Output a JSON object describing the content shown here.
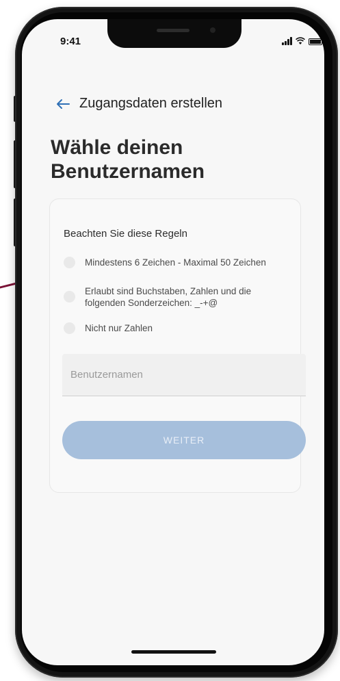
{
  "status_bar": {
    "time": "9:41"
  },
  "header": {
    "back_icon": "arrow-left-icon",
    "title": "Zugangsdaten erstellen"
  },
  "page": {
    "title_line1": "Wähle deinen",
    "title_line2": "Benutzernamen"
  },
  "rules": {
    "heading": "Beachten Sie diese Regeln",
    "items": [
      {
        "label": "Mindestens 6 Zeichen - Maximal 50 Zeichen",
        "checked": false
      },
      {
        "label": "Erlaubt sind Buchstaben, Zahlen und die folgenden Sonderzeichen: _-+@",
        "checked": false
      },
      {
        "label": "Nicht nur Zahlen",
        "checked": false
      }
    ]
  },
  "username_input": {
    "placeholder": "Benutzernamen",
    "value": ""
  },
  "next_button": {
    "label": "WEITER",
    "enabled": false
  },
  "colors": {
    "button_disabled": "#a6bfdc",
    "accent_line": "#7a1236",
    "back_arrow": "#2f6fb5"
  }
}
